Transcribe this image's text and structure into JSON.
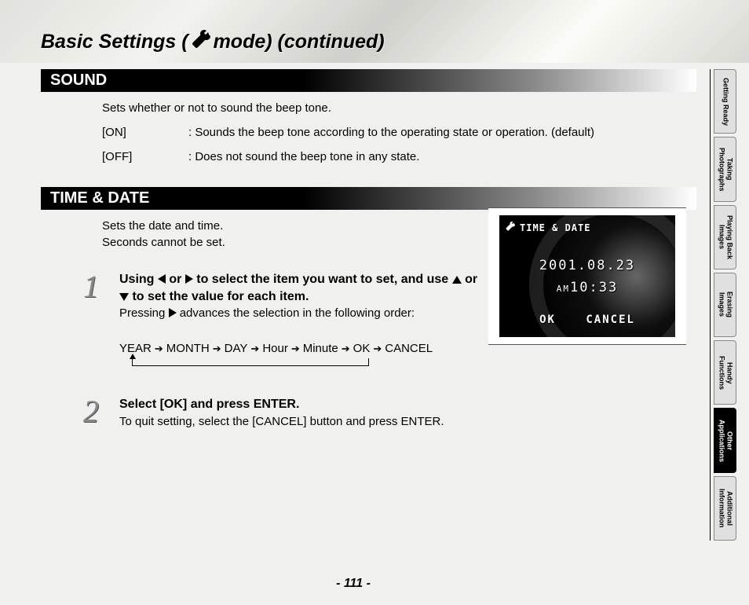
{
  "title_prefix": "Basic Settings (",
  "title_suffix": " mode) (continued)",
  "sound": {
    "heading": "SOUND",
    "intro": "Sets whether or not to sound the beep tone.",
    "options": [
      {
        "label": "[ON]",
        "desc": ": Sounds the beep tone according to the operating state or operation. (default)"
      },
      {
        "label": "[OFF]",
        "desc": ": Does not sound the beep tone in any state."
      }
    ]
  },
  "timedate": {
    "heading": "TIME & DATE",
    "intro1": "Sets the date and time.",
    "intro2": "Seconds cannot be set.",
    "step1": {
      "num": "1",
      "title_a": "Using ",
      "title_b": " or  ",
      "title_c": " to select the item you want to set, and use ",
      "title_d": " or ",
      "title_e": " to set the value for each item.",
      "text_a": "Pressing ",
      "text_b": " advances the selection in the following order:"
    },
    "sequence": [
      "YEAR",
      "MONTH",
      "DAY",
      "Hour",
      "Minute",
      "OK",
      "CANCEL"
    ],
    "step2": {
      "num": "2",
      "title": "Select [OK] and press ENTER.",
      "text": "To quit setting, select the [CANCEL] button and press ENTER."
    }
  },
  "lcd": {
    "header": "TIME & DATE",
    "date": "2001.08.23",
    "am": "AM",
    "time": "10:33",
    "ok": "OK",
    "cancel": "CANCEL"
  },
  "tabs": [
    "Getting Ready",
    "Taking Photographs",
    "Playing Back Images",
    "Erasing Images",
    "Handy Functions",
    "Other Applications",
    "Additional Information"
  ],
  "active_tab_index": 5,
  "page_number": "- 111 -"
}
